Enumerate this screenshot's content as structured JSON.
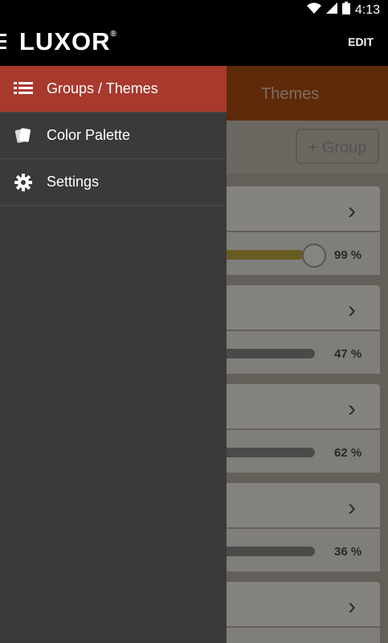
{
  "status": {
    "time": "4:13"
  },
  "app": {
    "logo": "LUXOR",
    "logo_mark": "®",
    "edit_label": "EDIT"
  },
  "main": {
    "tab_label": "Themes",
    "add_group_label": "+ Group",
    "cards": [
      {
        "percent_label": "99 %"
      },
      {
        "percent_label": "47 %"
      },
      {
        "percent_label": "62 %"
      },
      {
        "percent_label": "36 %"
      },
      {
        "percent_label": ""
      }
    ]
  },
  "drawer": {
    "items": [
      {
        "label": "Groups / Themes",
        "icon": "list-icon"
      },
      {
        "label": "Color Palette",
        "icon": "cards-icon"
      },
      {
        "label": "Settings",
        "icon": "gear-icon"
      }
    ]
  },
  "colors": {
    "drawer_active": "#a8392d",
    "drawer_bg": "#3a3a3a",
    "tab_bg": "#a94e13"
  }
}
